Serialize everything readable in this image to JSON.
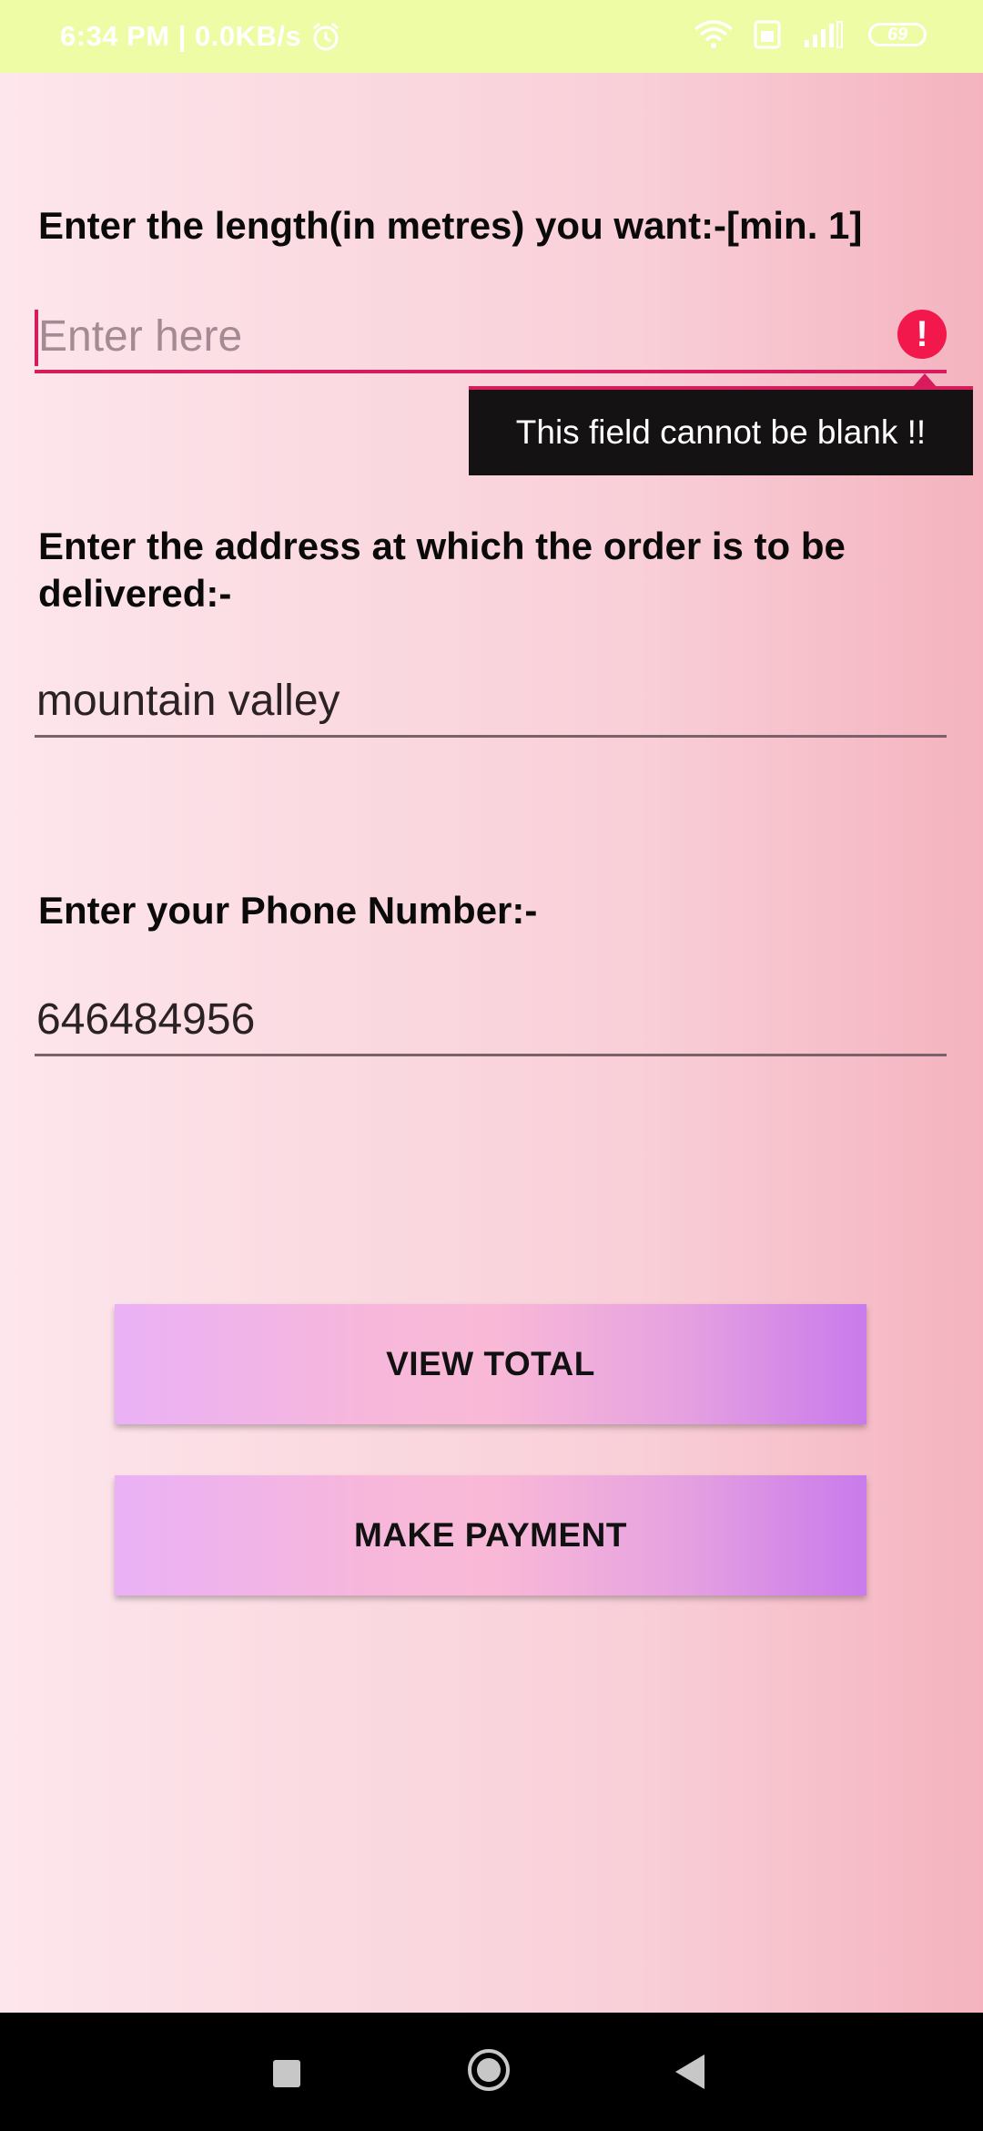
{
  "status_bar": {
    "time_and_speed": "6:34 PM | 0.0KB/s",
    "battery": "69"
  },
  "form": {
    "length_label": "Enter the length(in metres) you want:-[min. 1]",
    "length_placeholder": "Enter here",
    "length_error": "This field cannot be blank !!",
    "address_label": "Enter the address at which the order is to be delivered:-",
    "address_value": "mountain valley",
    "phone_label": "Enter your Phone Number:-",
    "phone_value": "646484956"
  },
  "buttons": {
    "view_total": "VIEW TOTAL",
    "make_payment": "MAKE PAYMENT"
  },
  "colors": {
    "accent_error": "#d81b5c",
    "status_bar_bg": "#eefca5"
  }
}
